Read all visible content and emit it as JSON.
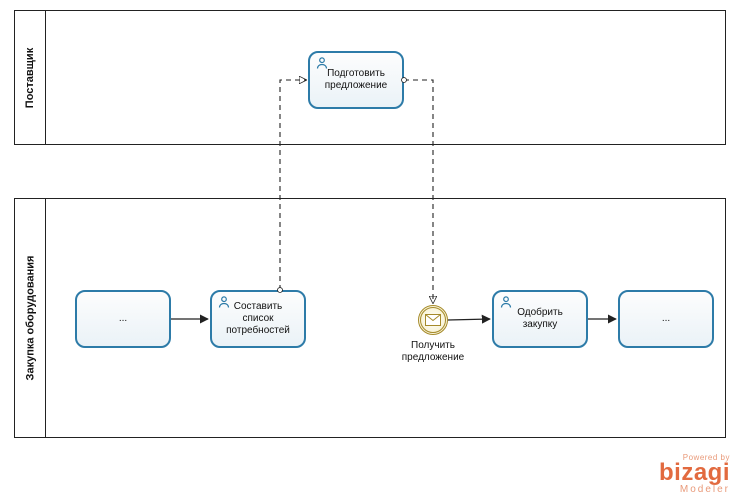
{
  "pools": {
    "supplier": {
      "label": "Поставщик"
    },
    "procurement": {
      "label": "Закупка оборудования"
    }
  },
  "tasks": {
    "prepare_offer": {
      "label": "Подготовить предложение"
    },
    "placeholder_left": {
      "label": "..."
    },
    "compile_needs": {
      "label": "Составить список потребностей"
    },
    "approve_purchase": {
      "label": "Одобрить закупку"
    },
    "placeholder_right": {
      "label": "..."
    }
  },
  "events": {
    "receive_offer": {
      "label": "Получить предложение"
    }
  },
  "logo": {
    "powered": "Powered by",
    "brand": "bizagi",
    "product": "Modeler"
  }
}
